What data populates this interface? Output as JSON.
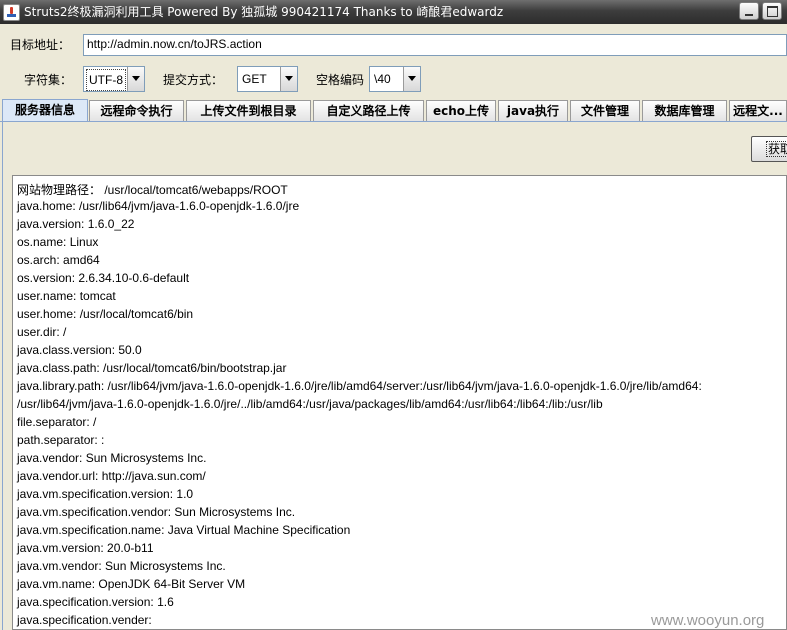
{
  "window": {
    "title": "Struts2终极漏洞利用工具   Powered By 独孤城 990421174 Thanks to 崎酿君edwardz"
  },
  "form": {
    "target_label": "目标地址：",
    "target_value": "http://admin.now.cn/toJRS.action",
    "charset_label": "字符集：",
    "charset_value": "UTF-8",
    "method_label": "提交方式：",
    "method_value": "GET",
    "space_label": "空格编码",
    "space_value": "\\40"
  },
  "tabs": [
    {
      "label": "服务器信息",
      "active": true
    },
    {
      "label": "远程命令执行"
    },
    {
      "label": "上传文件到根目录"
    },
    {
      "label": "自定义路径上传"
    },
    {
      "label": "echo上传"
    },
    {
      "label": "java执行"
    },
    {
      "label": "文件管理"
    },
    {
      "label": "数据库管理"
    },
    {
      "label": "远程文..."
    }
  ],
  "panel": {
    "get_button_label": "获取"
  },
  "output": [
    "网站物理路径： /usr/local/tomcat6/webapps/ROOT",
    "java.home: /usr/lib64/jvm/java-1.6.0-openjdk-1.6.0/jre",
    "java.version: 1.6.0_22",
    "os.name: Linux",
    "os.arch: amd64",
    "os.version: 2.6.34.10-0.6-default",
    "user.name: tomcat",
    "user.home: /usr/local/tomcat6/bin",
    "user.dir: /",
    "java.class.version: 50.0",
    "java.class.path: /usr/local/tomcat6/bin/bootstrap.jar",
    "java.library.path: /usr/lib64/jvm/java-1.6.0-openjdk-1.6.0/jre/lib/amd64/server:/usr/lib64/jvm/java-1.6.0-openjdk-1.6.0/jre/lib/amd64:",
    "/usr/lib64/jvm/java-1.6.0-openjdk-1.6.0/jre/../lib/amd64:/usr/java/packages/lib/amd64:/usr/lib64:/lib64:/lib:/usr/lib",
    "file.separator: /",
    "path.separator: :",
    "java.vendor: Sun Microsystems Inc.",
    "java.vendor.url: http://java.sun.com/",
    "java.vm.specification.version: 1.0",
    "java.vm.specification.vendor: Sun Microsystems Inc.",
    "java.vm.specification.name: Java Virtual Machine Specification",
    "java.vm.version: 20.0-b11",
    "java.vm.vendor: Sun Microsystems Inc.",
    "java.vm.name: OpenJDK 64-Bit Server VM",
    "java.specification.version: 1.6",
    "java.specification.vender:"
  ],
  "watermark": "www.wooyun.org",
  "icons": {
    "app": "java-coffee-icon",
    "minimize": "minimize-icon",
    "maximize": "maximize-icon",
    "dropdown": "chevron-down-icon"
  }
}
